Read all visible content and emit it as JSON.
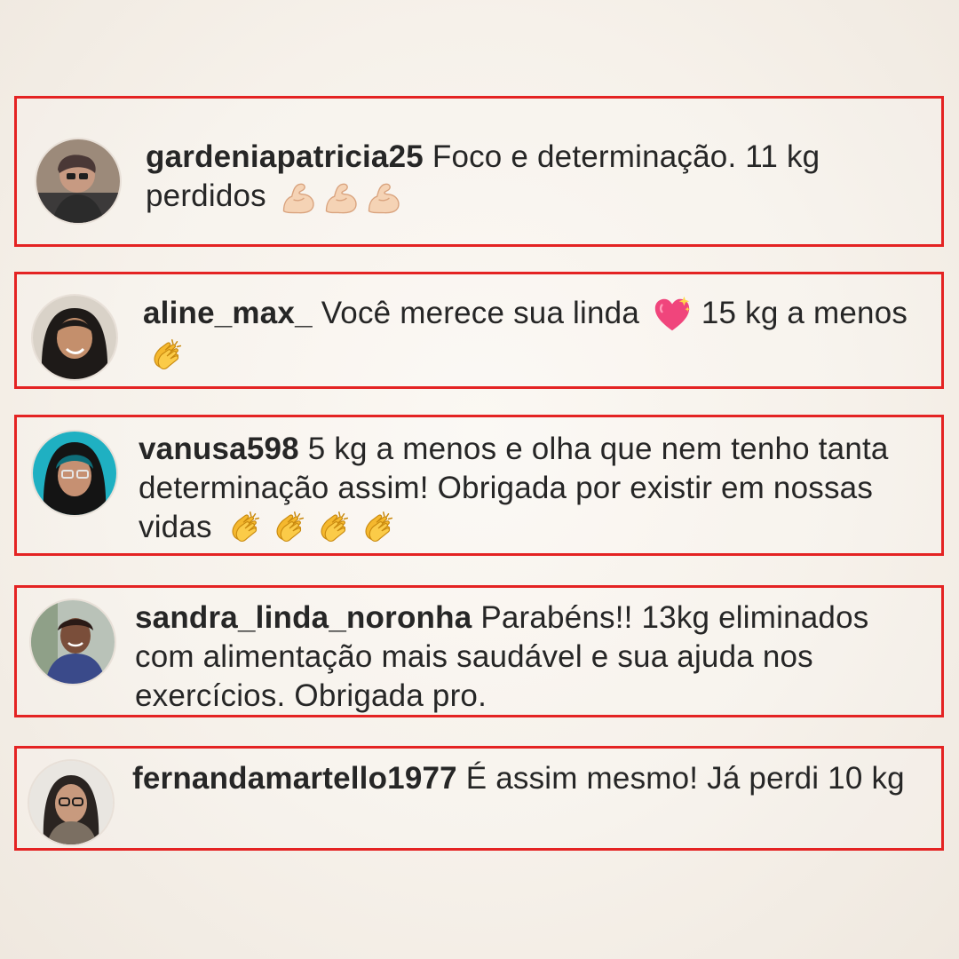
{
  "comments": [
    {
      "username": "gardeniapatricia25",
      "text": "Foco e determinação. 11 kg perdidos",
      "emojis": [
        "flexed-biceps-icon",
        "flexed-biceps-icon",
        "flexed-biceps-icon"
      ]
    },
    {
      "username": "aline_max_",
      "text_before": "Você merece sua linda",
      "heart_emoji": "sparkling-heart-icon",
      "text_after": "15 kg a menos",
      "emojis": [
        "clapping-hands-icon"
      ]
    },
    {
      "username": "vanusa598",
      "text": "5 kg a menos e olha que nem tenho tanta determinação assim! Obrigada por existir em nossas vidas",
      "emojis": [
        "clapping-hands-icon",
        "clapping-hands-icon",
        "clapping-hands-icon",
        "clapping-hands-icon"
      ]
    },
    {
      "username": "sandra_linda_noronha",
      "text": "Parabéns!! 13kg eliminados com alimentação mais saudável e sua ajuda nos exercícios.  Obrigada pro."
    },
    {
      "username": "fernandamartello1977",
      "text": "É assim mesmo! Já perdi 10 kg"
    }
  ],
  "colors": {
    "highlight_border": "#e42323",
    "text": "#262626"
  }
}
